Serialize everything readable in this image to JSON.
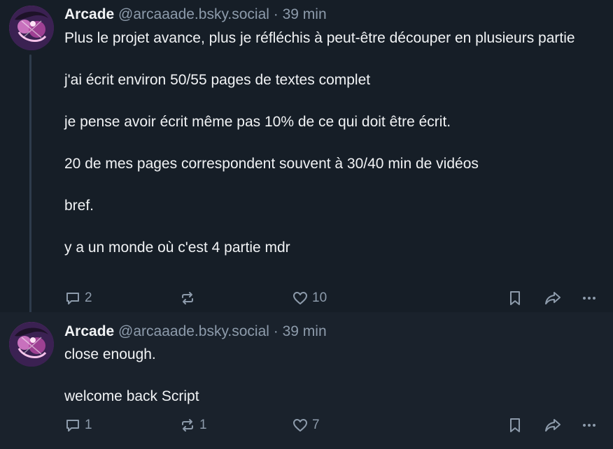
{
  "posts": [
    {
      "author": "Arcade",
      "handle": "@arcaaade.bsky.social",
      "separator": "·",
      "time": "39 min",
      "paragraphs": [
        "Plus le projet avance, plus je réfléchis à peut-être découper en plusieurs partie",
        "j'ai écrit environ 50/55 pages de textes complet",
        "je pense avoir écrit même pas 10% de ce qui doit être écrit.",
        "20 de mes pages correspondent souvent à 30/40 min de vidéos",
        "bref.",
        "y a un monde où c'est 4 partie mdr"
      ],
      "reply_count": "2",
      "repost_count": "",
      "like_count": "10"
    },
    {
      "author": "Arcade",
      "handle": "@arcaaade.bsky.social",
      "separator": "·",
      "time": "39 min",
      "paragraphs": [
        "close enough.",
        "welcome back Script"
      ],
      "reply_count": "1",
      "repost_count": "1",
      "like_count": "7"
    }
  ],
  "icons": {
    "reply": "speech-bubble-icon",
    "repost": "repost-arrows-icon",
    "like": "heart-icon",
    "bookmark": "bookmark-icon",
    "share": "share-arrow-icon",
    "more": "ellipsis-icon"
  },
  "colors": {
    "background": "#161e27",
    "text": "#f1f3f5",
    "muted": "#8d9bab",
    "thread_line": "#2e3b4b"
  }
}
